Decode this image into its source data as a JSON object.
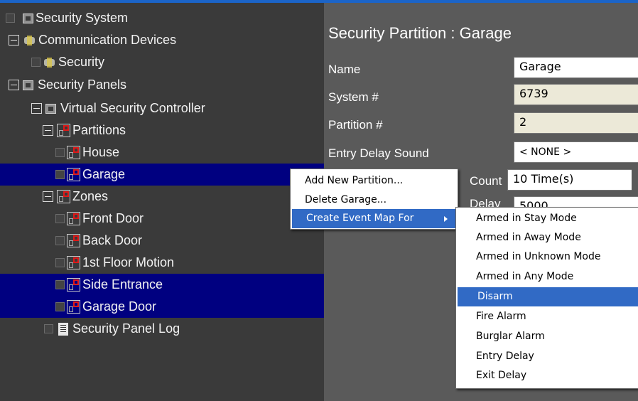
{
  "tree": [
    {
      "label": "Security System",
      "icon": "security-system-icon",
      "selected": false
    },
    {
      "label": "Communication Devices",
      "icon": "communication-devices-icon",
      "selected": false
    },
    {
      "label": "Security",
      "icon": "communication-device-icon",
      "selected": false
    },
    {
      "label": "Security Panels",
      "icon": "security-panels-icon",
      "selected": false
    },
    {
      "label": "Virtual Security Controller",
      "icon": "security-controller-icon",
      "selected": false
    },
    {
      "label": "Partitions",
      "icon": "partitions-icon",
      "selected": false
    },
    {
      "label": "House",
      "icon": "partition-icon",
      "selected": false
    },
    {
      "label": "Garage",
      "icon": "partition-icon",
      "selected": true
    },
    {
      "label": "Zones",
      "icon": "zones-icon",
      "selected": false
    },
    {
      "label": "Front Door",
      "icon": "zone-icon",
      "selected": false
    },
    {
      "label": "Back Door",
      "icon": "zone-icon",
      "selected": false
    },
    {
      "label": "1st Floor Motion",
      "icon": "zone-icon",
      "selected": false
    },
    {
      "label": "Side Entrance",
      "icon": "zone-icon",
      "selected": true
    },
    {
      "label": "Garage Door",
      "icon": "zone-icon",
      "selected": true
    },
    {
      "label": "Security Panel Log",
      "icon": "log-icon",
      "selected": false
    }
  ],
  "detail": {
    "title": "Security Partition : Garage",
    "fields": {
      "name": {
        "label": "Name",
        "value": "Garage"
      },
      "system": {
        "label": "System #",
        "value": "6739"
      },
      "partition": {
        "label": "Partition #",
        "value": "2"
      },
      "entry_delay_sound": {
        "label": "Entry Delay Sound",
        "value": "< NONE >"
      },
      "count": {
        "label_fragment": "Count",
        "value": "10 Time(s)"
      },
      "delay": {
        "label_fragment": "Delay",
        "value": "5000"
      }
    }
  },
  "context_menu": {
    "items": [
      "Add New Partition...",
      "Delete Garage...",
      "Create Event Map For"
    ],
    "highlighted": "Create Event Map For"
  },
  "submenu": {
    "items": [
      "Armed in Stay Mode",
      "Armed in Away Mode",
      "Armed in Unknown Mode",
      "Armed in Any Mode",
      "Disarm",
      "Fire Alarm",
      "Burglar Alarm",
      "Entry Delay",
      "Exit Delay"
    ],
    "highlighted": "Disarm"
  },
  "colors": {
    "selection": "#000080",
    "menu_highlight": "#316ac5",
    "left_pane": "#3a3a3a",
    "right_pane": "#5a5a5a",
    "title_bar": "#1b64c8"
  }
}
